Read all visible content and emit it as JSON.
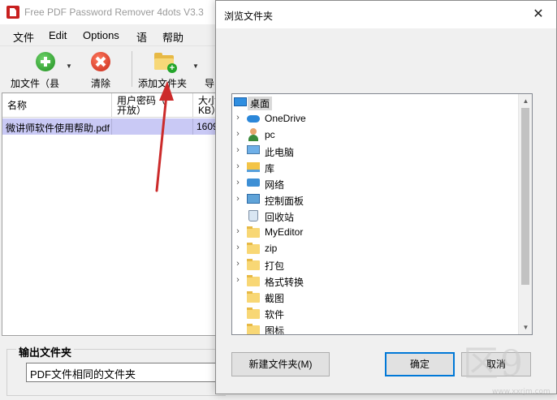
{
  "app": {
    "title": "Free PDF Password Remover 4dots V3.3",
    "menu": [
      "文件",
      "Edit",
      "Options",
      "语",
      "帮助"
    ],
    "toolbar": {
      "add_file": "加文件（县",
      "clear": "清除",
      "add_folder": "添加文件夹",
      "export": "导"
    },
    "table": {
      "columns": [
        "名称",
        "用户密码（\n开放）",
        "大小\nKB）"
      ],
      "rows": [
        {
          "name": "微讲师软件使用帮助.pdf",
          "user_password": "",
          "size": "1609"
        }
      ]
    },
    "output": {
      "legend": "输出文件夹",
      "value": "PDF文件相同的文件夹"
    }
  },
  "dialog": {
    "title": "浏览文件夹",
    "close_glyph": "✕",
    "tree": [
      {
        "label": "桌面",
        "icon": "desktop-icon",
        "expandable": false
      },
      {
        "label": "OneDrive",
        "icon": "cloud-icon",
        "expandable": true
      },
      {
        "label": "pc",
        "icon": "user-icon",
        "expandable": true
      },
      {
        "label": "此电脑",
        "icon": "computer-icon",
        "expandable": true
      },
      {
        "label": "库",
        "icon": "library-icon",
        "expandable": true
      },
      {
        "label": "网络",
        "icon": "network-icon",
        "expandable": true
      },
      {
        "label": "控制面板",
        "icon": "control-panel-icon",
        "expandable": true
      },
      {
        "label": "回收站",
        "icon": "recycle-bin-icon",
        "expandable": false
      },
      {
        "label": "MyEditor",
        "icon": "folder-icon",
        "expandable": true
      },
      {
        "label": "zip",
        "icon": "folder-icon",
        "expandable": true
      },
      {
        "label": "打包",
        "icon": "folder-icon",
        "expandable": true
      },
      {
        "label": "格式转换",
        "icon": "folder-icon",
        "expandable": true
      },
      {
        "label": "截图",
        "icon": "folder-icon",
        "expandable": false
      },
      {
        "label": "软件",
        "icon": "folder-icon",
        "expandable": false
      },
      {
        "label": "图标",
        "icon": "folder-icon",
        "expandable": false
      }
    ],
    "buttons": {
      "new_folder": "新建文件夹(M)",
      "ok": "确定",
      "cancel": "取消"
    }
  },
  "colors": {
    "selected_row": "#c9c9f5",
    "accent": "#0078d7",
    "arrow": "#cc2b2b"
  }
}
